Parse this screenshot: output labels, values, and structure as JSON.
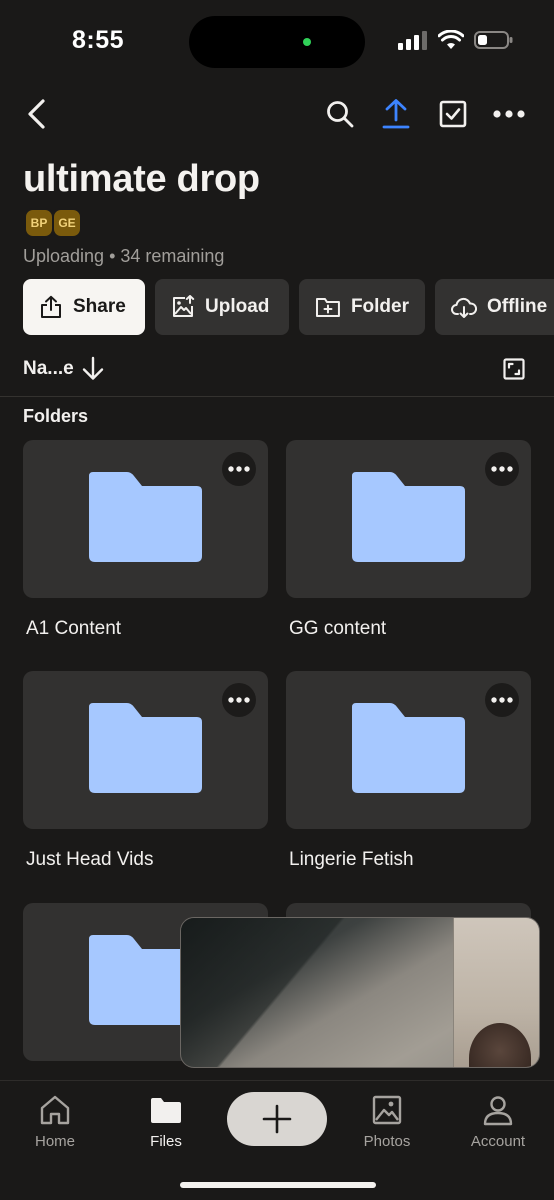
{
  "status": {
    "time": "8:55",
    "indicator_color": "#30d158"
  },
  "toolbar": {
    "icons": [
      "back-chevron-icon",
      "search-icon",
      "upload-arrow-icon",
      "select-checkbox-icon",
      "more-horizontal-icon"
    ],
    "accent_color": "#3d84ff"
  },
  "folder": {
    "title": "ultimate drop",
    "members": [
      "BP",
      "GE"
    ],
    "subtitle": "Uploading • 34 remaining"
  },
  "actions": [
    {
      "label": "Share",
      "icon": "share-icon"
    },
    {
      "label": "Upload",
      "icon": "upload-photo-icon"
    },
    {
      "label": "Folder",
      "icon": "new-folder-icon"
    },
    {
      "label": "Offline",
      "icon": "offline-download-icon"
    }
  ],
  "sort": {
    "label": "Na...e",
    "direction_icon": "arrow-down-icon",
    "view_icon": "grid-view-icon"
  },
  "section": {
    "title": "Folders"
  },
  "folders": [
    {
      "name": "A1 Content"
    },
    {
      "name": "GG content"
    },
    {
      "name": "Just Head Vids"
    },
    {
      "name": "Lingerie Fetish"
    },
    {
      "name": ""
    },
    {
      "name": ""
    }
  ],
  "folder_color": "#a6c8ff",
  "tabs": [
    {
      "label": "Home",
      "icon": "home-icon"
    },
    {
      "label": "Files",
      "icon": "files-folder-icon"
    },
    {
      "label": "Photos",
      "icon": "photos-icon"
    },
    {
      "label": "Account",
      "icon": "account-icon"
    }
  ],
  "fab": {
    "icon": "plus-icon"
  }
}
